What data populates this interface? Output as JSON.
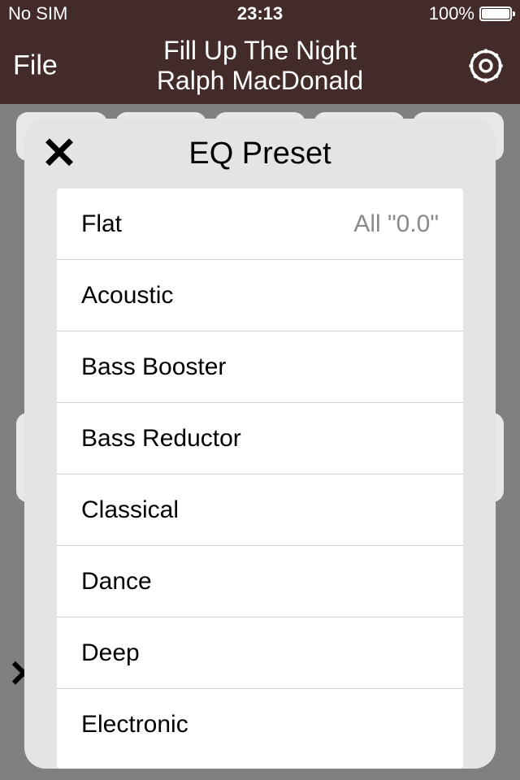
{
  "statusbar": {
    "carrier": "No SIM",
    "time": "23:13",
    "battery_pct": "100%"
  },
  "header": {
    "file_label": "File",
    "title_line1": "Fill Up The Night",
    "title_line2": "Ralph MacDonald"
  },
  "modal": {
    "title": "EQ Preset",
    "items": [
      {
        "label": "Flat",
        "detail": "All \"0.0\""
      },
      {
        "label": "Acoustic",
        "detail": ""
      },
      {
        "label": "Bass Booster",
        "detail": ""
      },
      {
        "label": "Bass Reductor",
        "detail": ""
      },
      {
        "label": "Classical",
        "detail": ""
      },
      {
        "label": "Dance",
        "detail": ""
      },
      {
        "label": "Deep",
        "detail": ""
      },
      {
        "label": "Electronic",
        "detail": ""
      }
    ]
  }
}
